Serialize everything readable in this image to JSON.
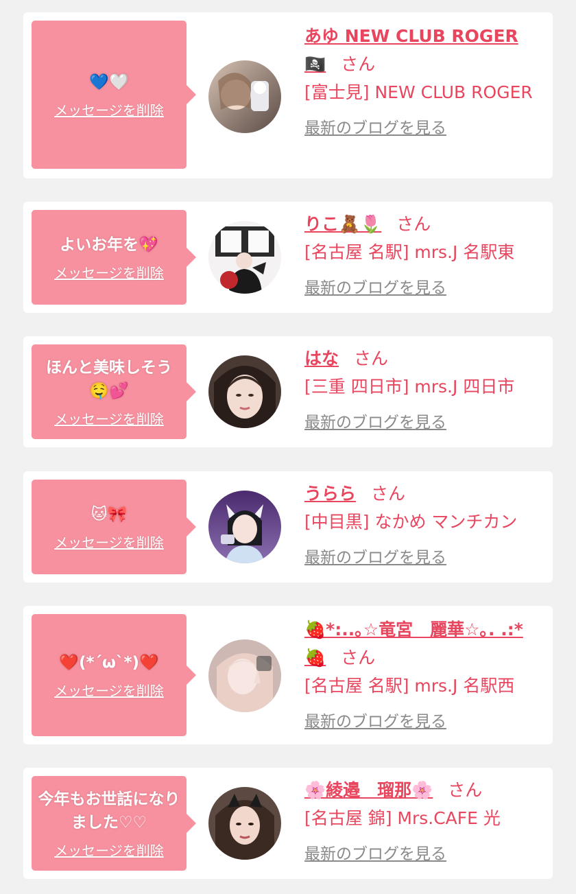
{
  "items": [
    {
      "message": "💙🤍",
      "delete_label": "メッセージを削除",
      "name": "あゆ NEW CLUB ROGER 🏴‍☠️",
      "suffix": "さん",
      "shop": "[富士見] NEW CLUB ROGER",
      "blog_label": "最新のブログを見る",
      "avatar_icon": "avatar-photo"
    },
    {
      "message": "よいお年を💖",
      "delete_label": "メッセージを削除",
      "name": "りこ🧸🌷",
      "suffix": "さん",
      "shop": "[名古屋 名駅] mrs.J 名駅東",
      "blog_label": "最新のブログを見る",
      "avatar_icon": "avatar-photo"
    },
    {
      "message": "ほんと美味しそう🤤💕",
      "delete_label": "メッセージを削除",
      "name": "はな",
      "suffix": "さん",
      "shop": "[三重 四日市] mrs.J 四日市",
      "blog_label": "最新のブログを見る",
      "avatar_icon": "avatar-photo"
    },
    {
      "message": "🐱🎀",
      "delete_label": "メッセージを削除",
      "name": "うらら",
      "suffix": "さん",
      "shop": "[中目黒] なかめ マンチカン",
      "blog_label": "最新のブログを見る",
      "avatar_icon": "avatar-photo"
    },
    {
      "message": "❤️(*´ω`*)❤️",
      "delete_label": "メッセージを削除",
      "name": "🍓*:..｡☆竜宮　麗華☆｡. .:* 🍓",
      "suffix": "さん",
      "shop": "[名古屋 名駅] mrs.J 名駅西",
      "blog_label": "最新のブログを見る",
      "avatar_icon": "avatar-photo"
    },
    {
      "message": "今年もお世話になりました♡♡",
      "delete_label": "メッセージを削除",
      "name": "🌸綾邉　瑠那🌸",
      "suffix": "さん",
      "shop": "[名古屋 錦] Mrs.CAFE 光",
      "blog_label": "最新のブログを見る",
      "avatar_icon": "avatar-photo"
    }
  ],
  "colors": {
    "accent": "#e8465e",
    "bubble": "#f7919f",
    "background": "#f1f1f1",
    "link_gray": "#8a8a8a"
  }
}
